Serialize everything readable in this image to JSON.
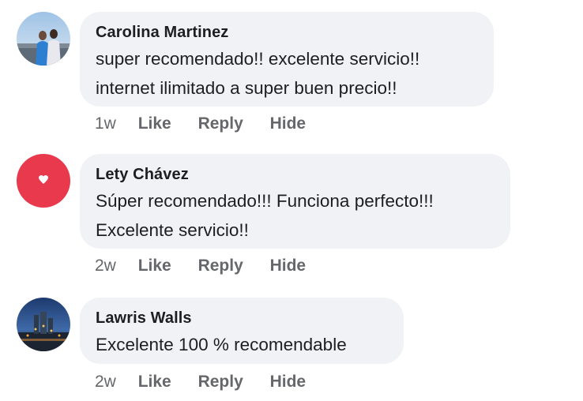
{
  "comments": [
    {
      "author": "Carolina Martinez",
      "lines": [
        "super recomendado!! excelente servicio!!",
        "internet ilimitado a super buen precio!!"
      ],
      "time": "1w",
      "like": "Like",
      "reply": "Reply",
      "hide": "Hide",
      "avatar_icon": "photo-avatar"
    },
    {
      "author": "Lety Chávez",
      "lines": [
        "Súper recomendado!!! Funciona perfecto!!!",
        "Excelente servicio!!"
      ],
      "time": "2w",
      "like": "Like",
      "reply": "Reply",
      "hide": "Hide",
      "avatar_icon": "heart-icon",
      "avatar_color": "#e8394d"
    },
    {
      "author": "Lawris Walls",
      "lines": [
        "Excelente 100 % recomendable"
      ],
      "time": "2w",
      "like": "Like",
      "reply": "Reply",
      "hide": "Hide",
      "avatar_icon": "photo-avatar"
    }
  ],
  "colors": {
    "bubble": "#f0f2f5",
    "text": "#1c1e21",
    "meta": "#65676b"
  }
}
